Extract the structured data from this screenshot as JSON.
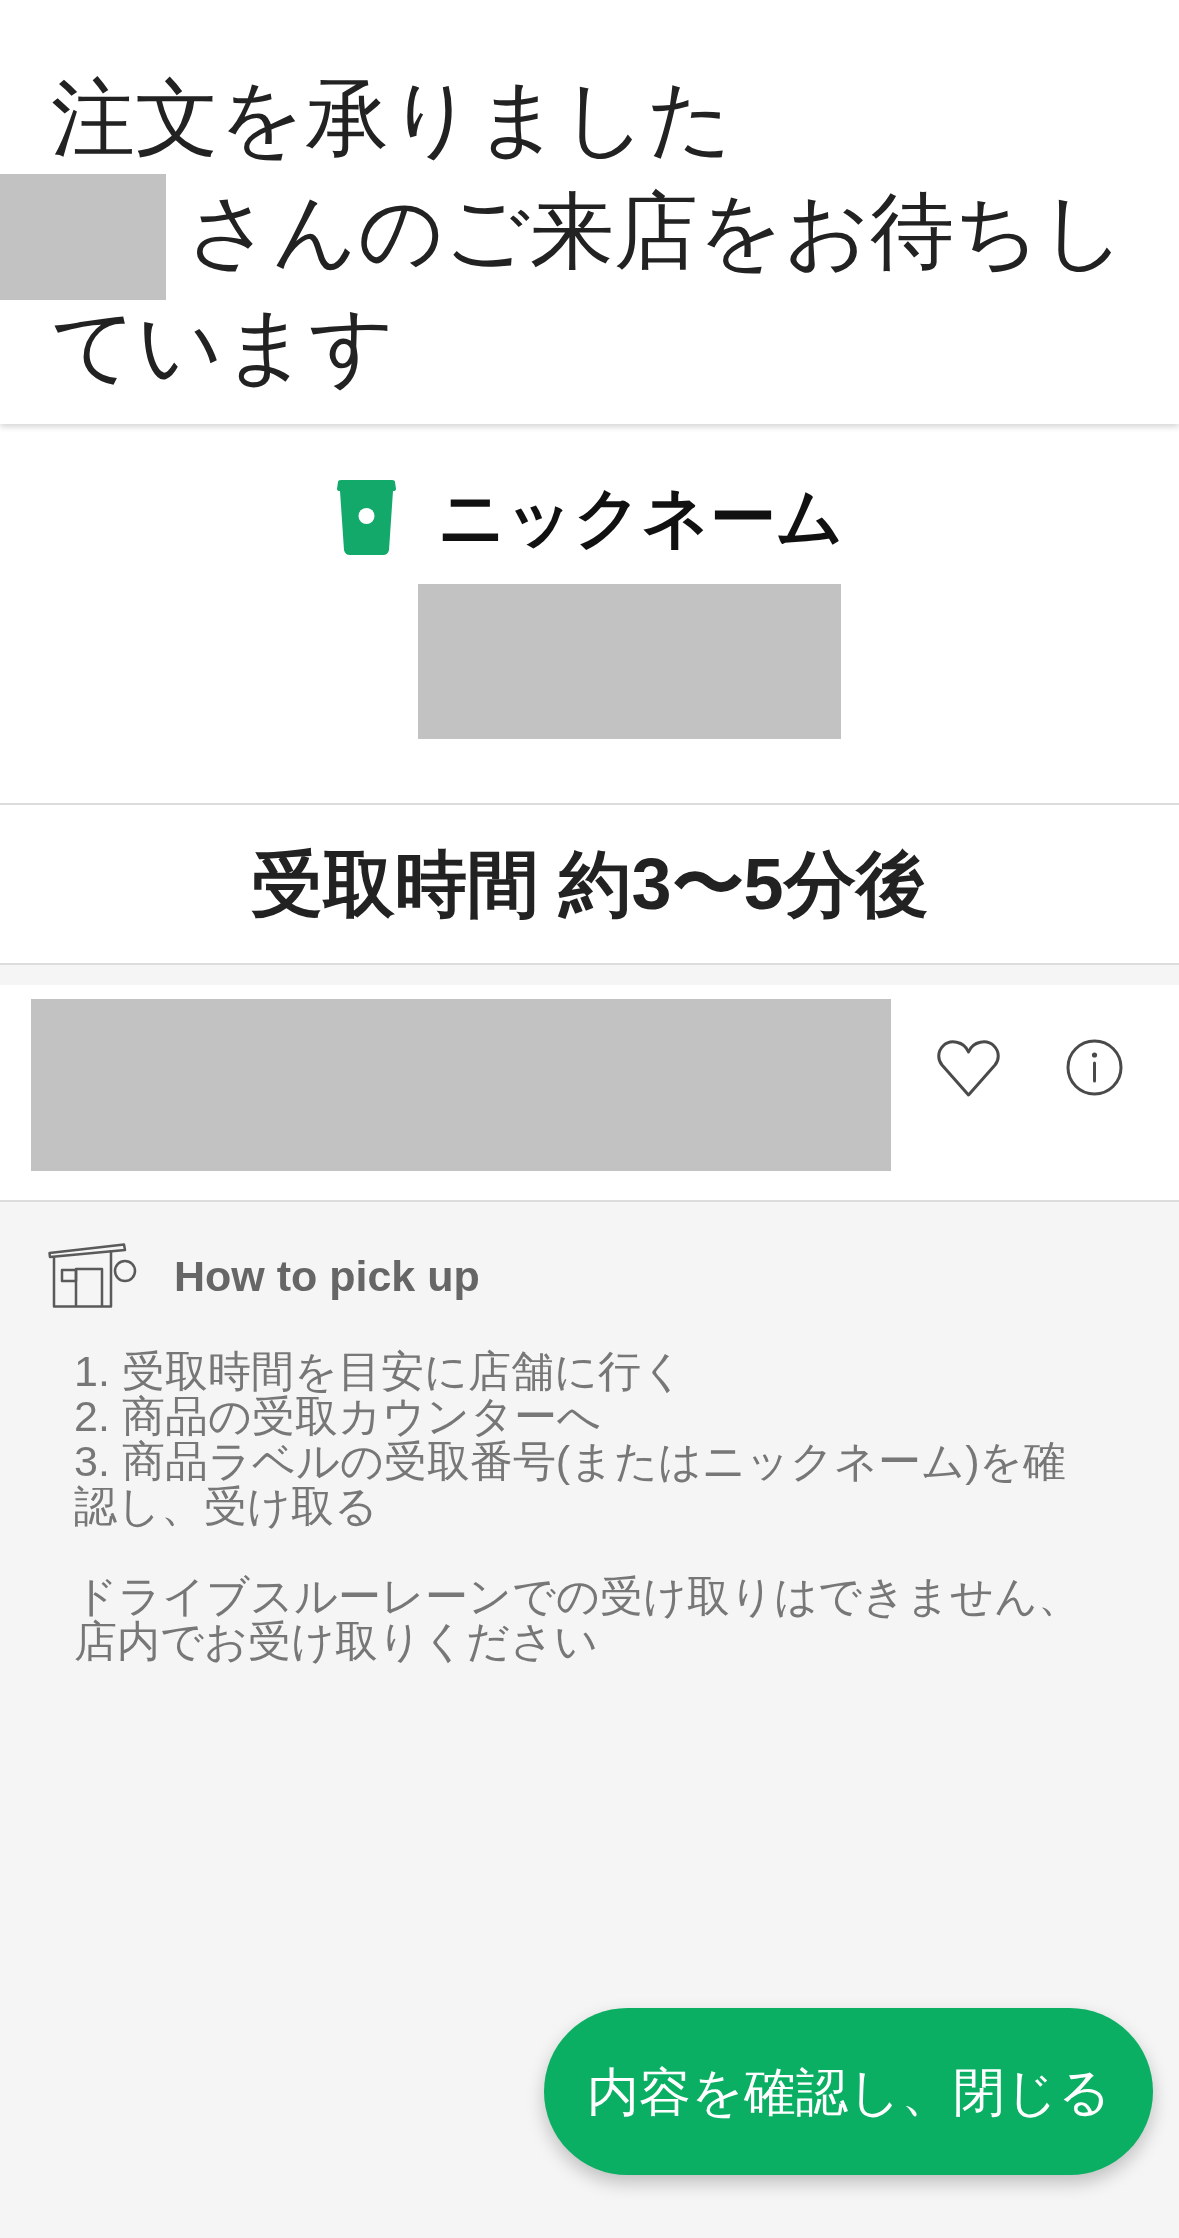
{
  "header": {
    "title": "注文を承りました",
    "greeting": "さんのご来店をお待ちしています"
  },
  "nickname": {
    "label": "ニックネーム"
  },
  "pickup_time": {
    "text": "受取時間 約3〜5分後"
  },
  "store_row": {
    "favorited": false
  },
  "how_to": {
    "title": "How to pick up",
    "steps": [
      "1. 受取時間を目安に店舗に行く",
      "2. 商品の受取カウンターへ",
      "3. 商品ラベルの受取番号(またはニックネーム)を確認し、受け取る"
    ],
    "note": "ドライブスルーレーンでの受け取りはできません、店内でお受け取りください"
  },
  "confirm_button": {
    "label": "内容を確認し、閉じる"
  }
}
